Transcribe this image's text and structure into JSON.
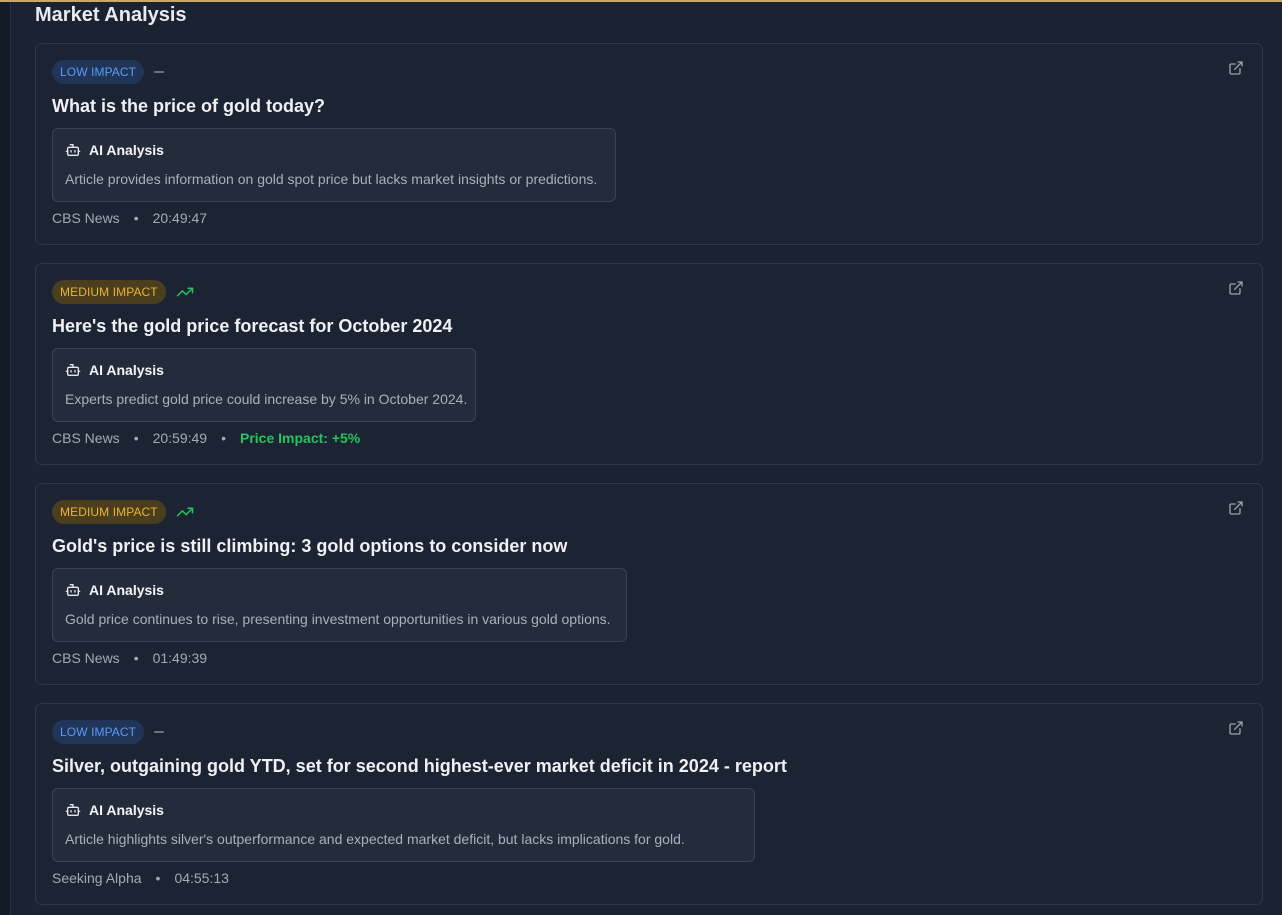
{
  "page": {
    "title": "Market Analysis"
  },
  "colors": {
    "accent": "#c9a96a",
    "low_impact": "#5b9bf5",
    "medium_impact": "#e9b530",
    "positive": "#22c55e"
  },
  "articles": [
    {
      "impact": "LOW IMPACT",
      "impact_level": "low",
      "trend_icon": "dash-icon",
      "headline": "What is the price of gold today?",
      "ai_label": "AI Analysis",
      "ai_text": "Article provides information on gold spot price but lacks market insights or predictions.",
      "source": "CBS News",
      "time": "20:49:47",
      "price_impact": ""
    },
    {
      "impact": "MEDIUM IMPACT",
      "impact_level": "medium",
      "trend_icon": "trending-up-icon",
      "headline": "Here's the gold price forecast for October 2024",
      "ai_label": "AI Analysis",
      "ai_text": "Experts predict gold price could increase by 5% in October 2024.",
      "source": "CBS News",
      "time": "20:59:49",
      "price_impact": "Price Impact: +5%"
    },
    {
      "impact": "MEDIUM IMPACT",
      "impact_level": "medium",
      "trend_icon": "trending-up-icon",
      "headline": "Gold's price is still climbing: 3 gold options to consider now",
      "ai_label": "AI Analysis",
      "ai_text": "Gold price continues to rise, presenting investment opportunities in various gold options.",
      "source": "CBS News",
      "time": "01:49:39",
      "price_impact": ""
    },
    {
      "impact": "LOW IMPACT",
      "impact_level": "low",
      "trend_icon": "dash-icon",
      "headline": "Silver, outgaining gold YTD, set for second highest-ever market deficit in 2024 - report",
      "ai_label": "AI Analysis",
      "ai_text": "Article highlights silver's outperformance and expected market deficit, but lacks implications for gold.",
      "source": "Seeking Alpha",
      "time": "04:55:13",
      "price_impact": ""
    }
  ],
  "bullet": "•"
}
